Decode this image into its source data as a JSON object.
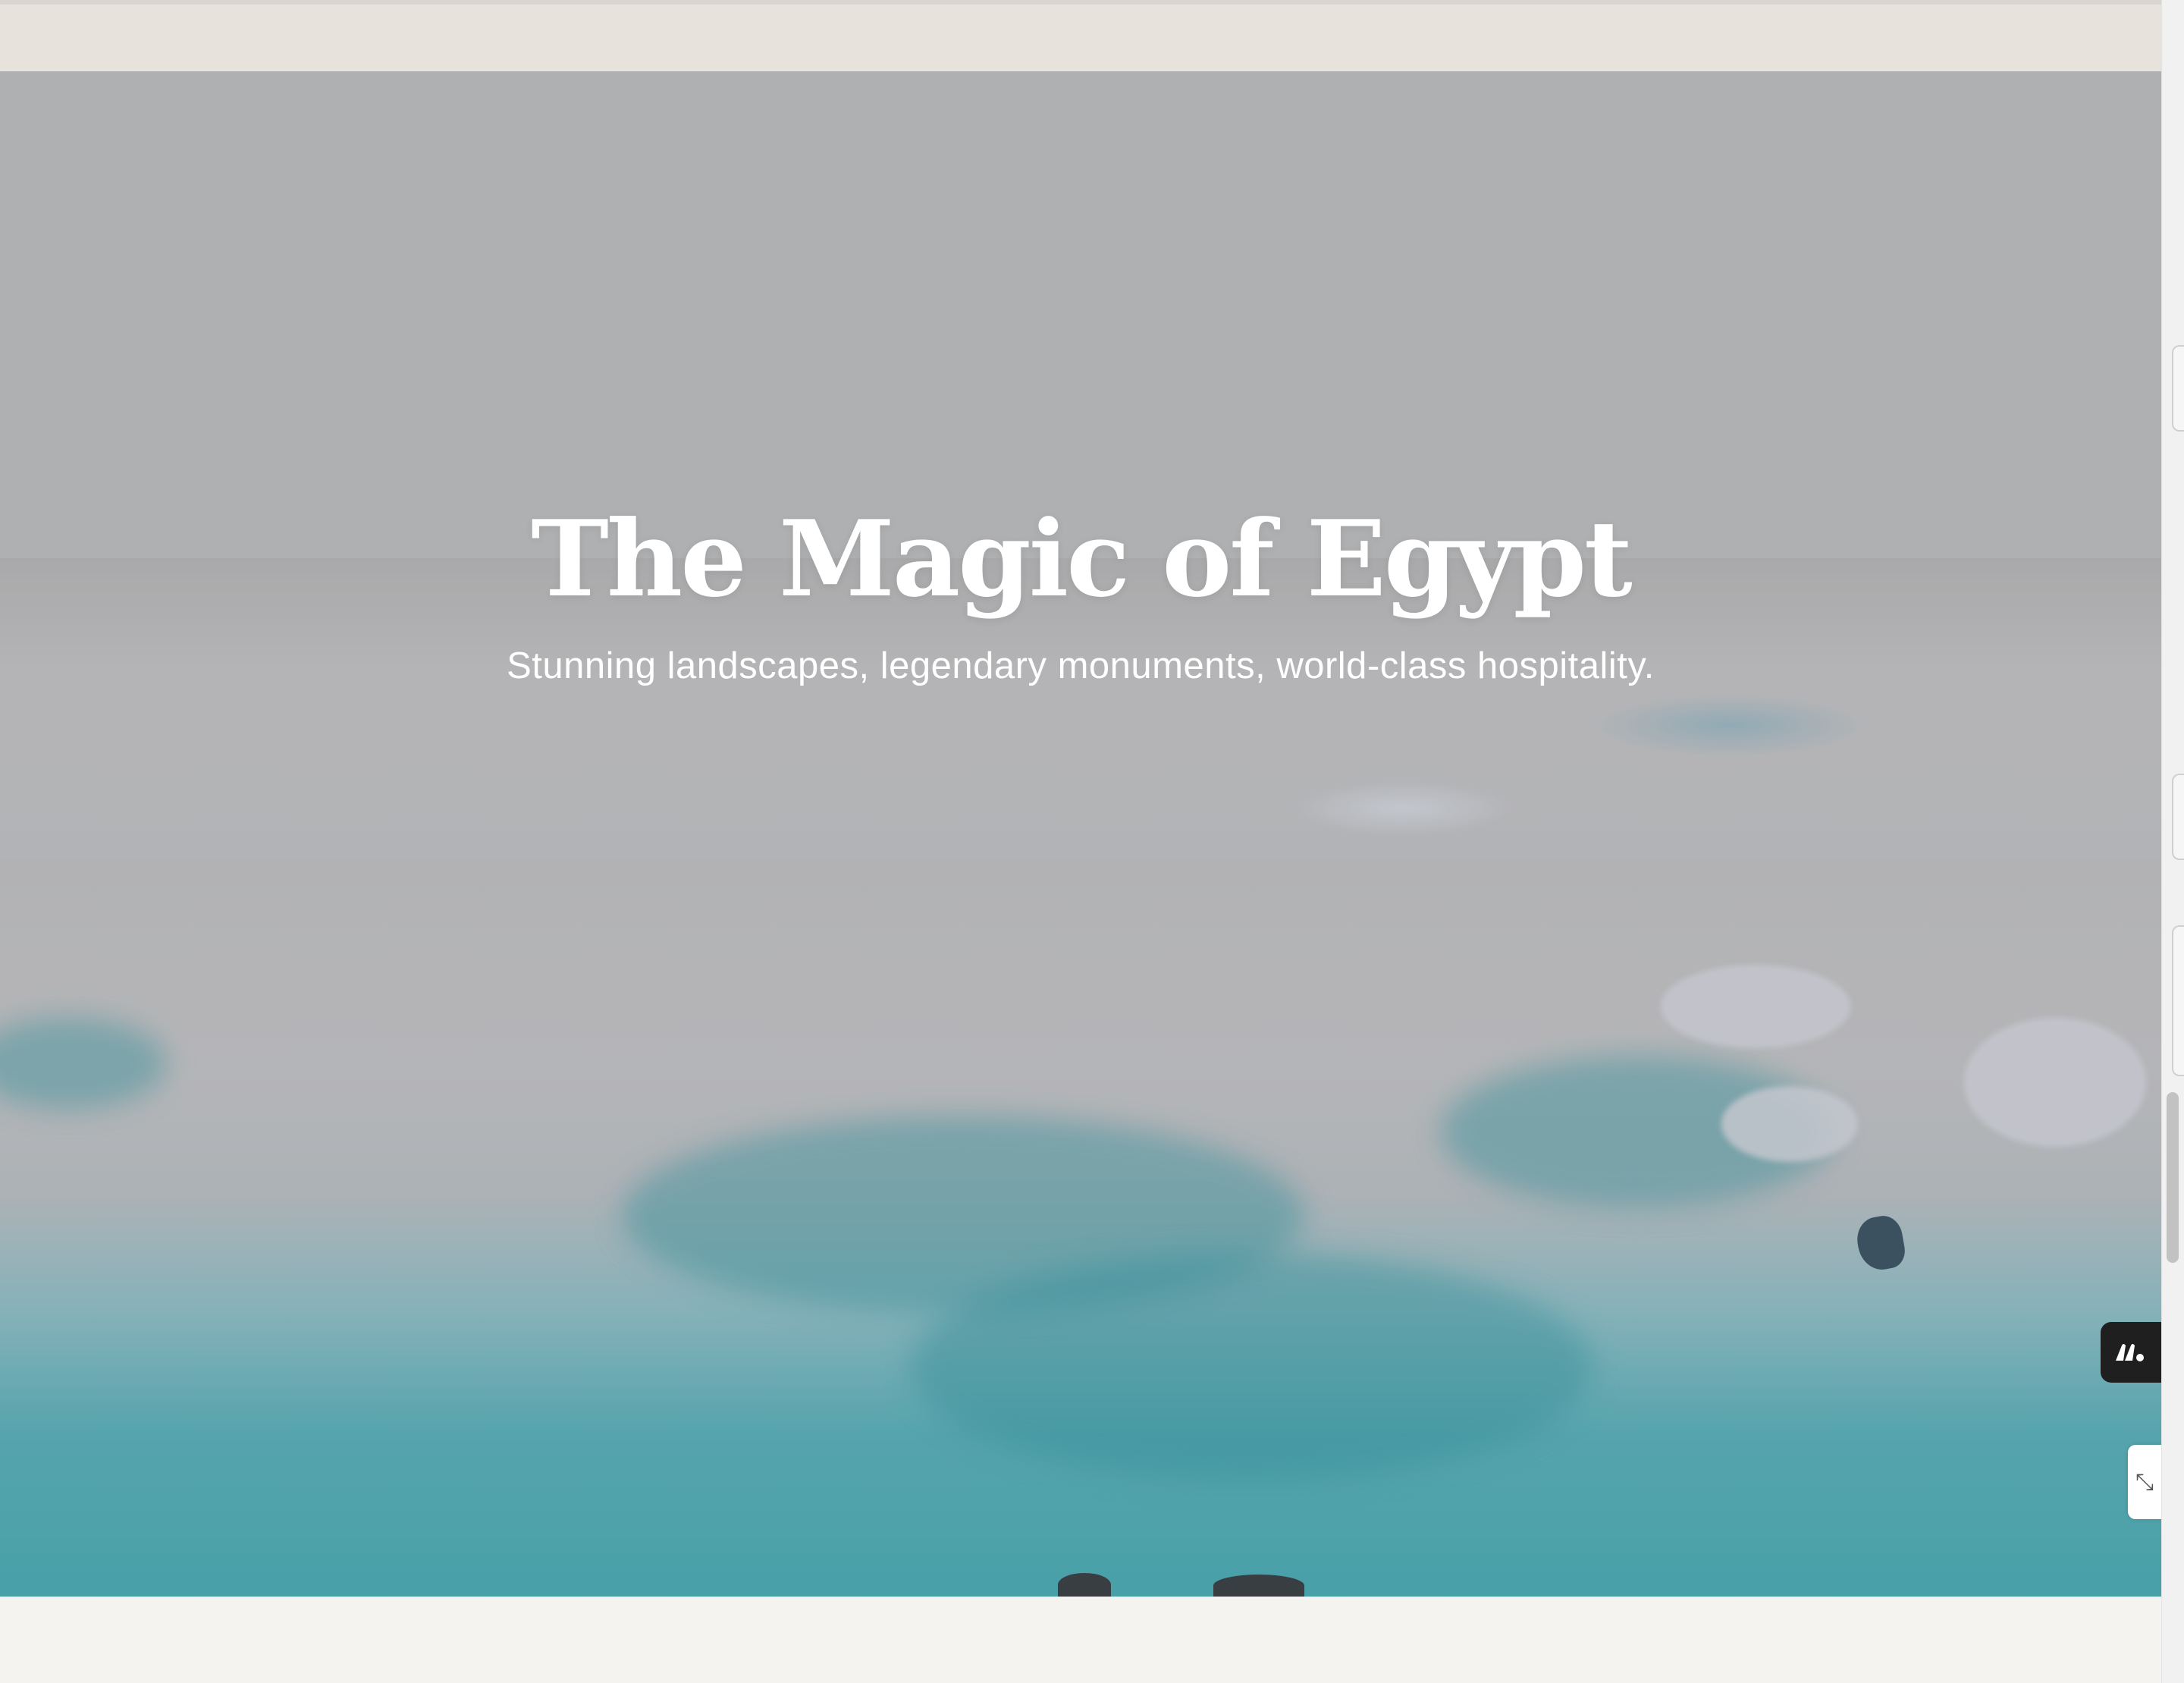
{
  "hero": {
    "title": "The Magic of Egypt",
    "subtitle": "Stunning landscapes, legendary monuments, world-class hospitality."
  },
  "widgets": {
    "dark_widget_icon": "brand-logo-icon",
    "light_widget_icon": "resize-handle-icon"
  },
  "colors": {
    "topbar": "#e8e2dc",
    "hero_overlay_gray": "#b0b1b2",
    "water_teal": "#3b9fa8",
    "page_background": "#f4f3f0",
    "widget_dark": "#1f1f1f"
  }
}
